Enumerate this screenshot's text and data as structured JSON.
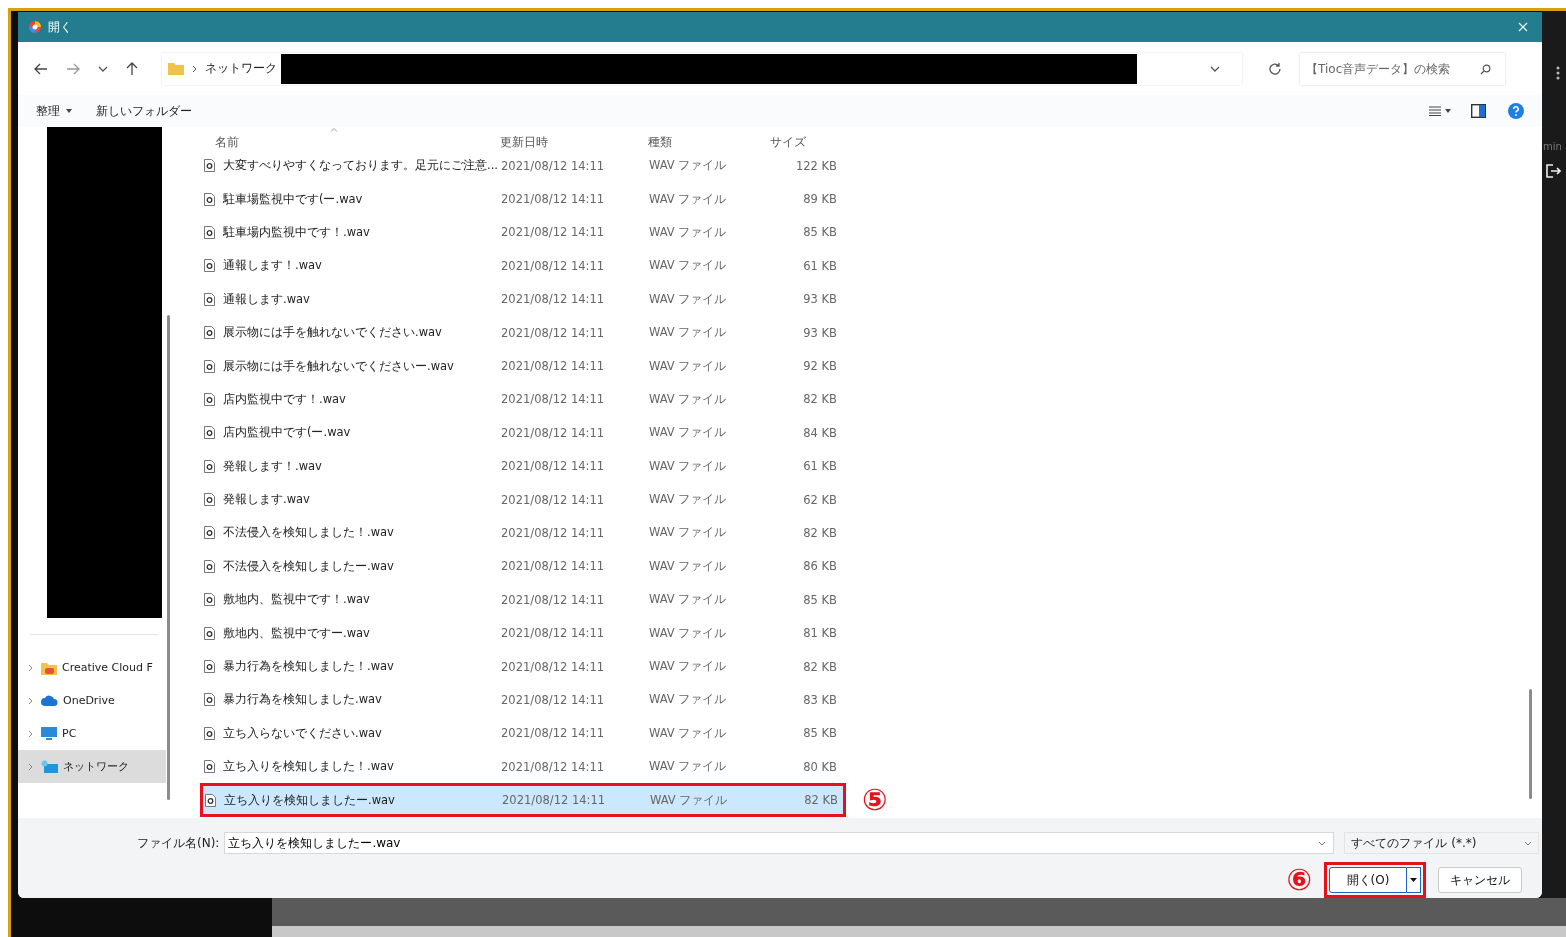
{
  "window": {
    "title": "開く"
  },
  "address": {
    "breadcrumb": "ネットワーク",
    "search": {
      "placeholder": "【Tioc音声データ】の検索"
    }
  },
  "toolbar": {
    "organize": "整理",
    "new_folder": "新しいフォルダー"
  },
  "sidebar": {
    "items": [
      {
        "label": "Creative Cloud F",
        "kind": "cloud-folder",
        "selected": false
      },
      {
        "label": "OneDrive",
        "kind": "cloud",
        "selected": false
      },
      {
        "label": "PC",
        "kind": "pc",
        "selected": false
      },
      {
        "label": "ネットワーク",
        "kind": "network",
        "selected": true
      }
    ]
  },
  "table": {
    "columns": [
      "名前",
      "更新日時",
      "種類",
      "サイズ"
    ],
    "rows": [
      {
        "name": "大変すべりやすくなっております。足元にご注意...",
        "modified": "2021/08/12 14:11",
        "type": "WAV ファイル",
        "size": "122 KB",
        "selected": false
      },
      {
        "name": "駐車場監視中です(ー.wav",
        "modified": "2021/08/12 14:11",
        "type": "WAV ファイル",
        "size": "89 KB",
        "selected": false
      },
      {
        "name": "駐車場内監視中です！.wav",
        "modified": "2021/08/12 14:11",
        "type": "WAV ファイル",
        "size": "85 KB",
        "selected": false
      },
      {
        "name": "通報します！.wav",
        "modified": "2021/08/12 14:11",
        "type": "WAV ファイル",
        "size": "61 KB",
        "selected": false
      },
      {
        "name": "通報します.wav",
        "modified": "2021/08/12 14:11",
        "type": "WAV ファイル",
        "size": "93 KB",
        "selected": false
      },
      {
        "name": "展示物には手を触れないでください.wav",
        "modified": "2021/08/12 14:11",
        "type": "WAV ファイル",
        "size": "93 KB",
        "selected": false
      },
      {
        "name": "展示物には手を触れないでくださいー.wav",
        "modified": "2021/08/12 14:11",
        "type": "WAV ファイル",
        "size": "92 KB",
        "selected": false
      },
      {
        "name": "店内監視中です！.wav",
        "modified": "2021/08/12 14:11",
        "type": "WAV ファイル",
        "size": "82 KB",
        "selected": false
      },
      {
        "name": "店内監視中です(ー.wav",
        "modified": "2021/08/12 14:11",
        "type": "WAV ファイル",
        "size": "84 KB",
        "selected": false
      },
      {
        "name": "発報します！.wav",
        "modified": "2021/08/12 14:11",
        "type": "WAV ファイル",
        "size": "61 KB",
        "selected": false
      },
      {
        "name": "発報します.wav",
        "modified": "2021/08/12 14:11",
        "type": "WAV ファイル",
        "size": "62 KB",
        "selected": false
      },
      {
        "name": "不法侵入を検知しました！.wav",
        "modified": "2021/08/12 14:11",
        "type": "WAV ファイル",
        "size": "82 KB",
        "selected": false
      },
      {
        "name": "不法侵入を検知しましたー.wav",
        "modified": "2021/08/12 14:11",
        "type": "WAV ファイル",
        "size": "86 KB",
        "selected": false
      },
      {
        "name": "敷地内、監視中です！.wav",
        "modified": "2021/08/12 14:11",
        "type": "WAV ファイル",
        "size": "85 KB",
        "selected": false
      },
      {
        "name": "敷地内、監視中ですー.wav",
        "modified": "2021/08/12 14:11",
        "type": "WAV ファイル",
        "size": "81 KB",
        "selected": false
      },
      {
        "name": "暴力行為を検知しました！.wav",
        "modified": "2021/08/12 14:11",
        "type": "WAV ファイル",
        "size": "82 KB",
        "selected": false
      },
      {
        "name": "暴力行為を検知しました.wav",
        "modified": "2021/08/12 14:11",
        "type": "WAV ファイル",
        "size": "83 KB",
        "selected": false
      },
      {
        "name": "立ち入らないでください.wav",
        "modified": "2021/08/12 14:11",
        "type": "WAV ファイル",
        "size": "85 KB",
        "selected": false
      },
      {
        "name": "立ち入りを検知しました！.wav",
        "modified": "2021/08/12 14:11",
        "type": "WAV ファイル",
        "size": "80 KB",
        "selected": false
      },
      {
        "name": "立ち入りを検知しましたー.wav",
        "modified": "2021/08/12 14:11",
        "type": "WAV ファイル",
        "size": "82 KB",
        "selected": true,
        "annotation": "⑤"
      }
    ]
  },
  "filename": {
    "label": "ファイル名(N):",
    "value": "立ち入りを検知しましたー.wav"
  },
  "filter": "すべてのファイル (*.*)",
  "open_button": {
    "label": "開く(O)",
    "annotation": "⑥"
  },
  "cancel_button": "キャンセル",
  "background": {
    "text": "min"
  }
}
